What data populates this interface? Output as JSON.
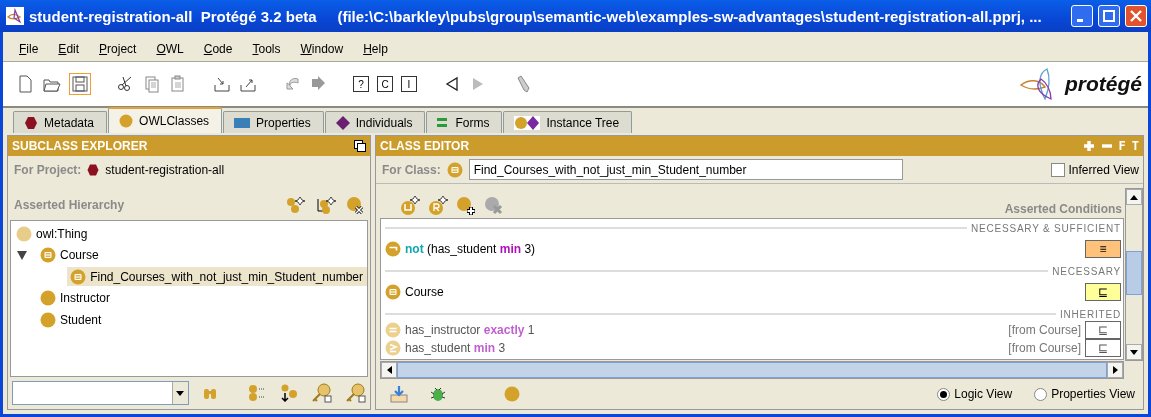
{
  "window": {
    "title": "student-registration-all  Protégé 3.2 beta     (file:\\C:\\barkley\\pubs\\group\\semantic-web\\examples-sw-advantages\\student-registration-all.pprj, ..."
  },
  "menu": [
    "File",
    "Edit",
    "Project",
    "OWL",
    "Code",
    "Tools",
    "Window",
    "Help"
  ],
  "toolbar": {
    "query_buttons": [
      "?",
      "C",
      "I"
    ],
    "logo": "protégé"
  },
  "tabs": [
    {
      "label": "Metadata",
      "kind": "hexagon",
      "selected": false
    },
    {
      "label": "OWLClasses",
      "kind": "circle",
      "selected": true
    },
    {
      "label": "Properties",
      "kind": "rectangle",
      "selected": false
    },
    {
      "label": "Individuals",
      "kind": "diamond",
      "selected": false
    },
    {
      "label": "Forms",
      "kind": "bars",
      "selected": false
    },
    {
      "label": "Instance Tree",
      "kind": "circle-diamond",
      "selected": false
    }
  ],
  "subclass_explorer": {
    "title": "SUBCLASS EXPLORER",
    "project_label": "For Project:",
    "project": "student-registration-all",
    "hierarchy_label": "Asserted Hierarchy",
    "tree": [
      {
        "label": "owl:Thing",
        "kind": "thing",
        "selected": false,
        "children": [
          {
            "label": "Course",
            "kind": "defined",
            "selected": false,
            "expanded": true,
            "children": [
              {
                "label": "Find_Courses_with_not_just_min_Student_number",
                "kind": "defined",
                "selected": true
              }
            ]
          },
          {
            "label": "Instructor",
            "kind": "primitive",
            "selected": false
          },
          {
            "label": "Student",
            "kind": "primitive",
            "selected": false
          }
        ]
      }
    ]
  },
  "class_editor": {
    "title": "CLASS EDITOR",
    "header_buttons": [
      "F",
      "T"
    ],
    "for_class_label": "For Class:",
    "class_name": "Find_Courses_with_not_just_min_Student_number",
    "inferred_view": {
      "label": "Inferred View",
      "checked": false
    },
    "conditions_label": "Asserted Conditions",
    "sections": [
      {
        "title": "NECESSARY & SUFFICIENT",
        "kind": "equivalent",
        "conditions": [
          {
            "kind": "negation",
            "inherited": false,
            "marker": "≡",
            "parts": [
              {
                "text": "not",
                "kind": "negation"
              },
              {
                "text": " (has_student "
              },
              {
                "text": "min",
                "kind": "restriction"
              },
              {
                "text": " 3)"
              }
            ]
          }
        ]
      },
      {
        "title": "NECESSARY",
        "kind": "necessary",
        "conditions": [
          {
            "kind": "class",
            "inherited": false,
            "marker": "⊑",
            "parts": [
              {
                "text": "Course"
              }
            ]
          }
        ]
      },
      {
        "title": "INHERITED",
        "kind": "inherited",
        "conditions": [
          {
            "kind": "exact",
            "inherited": true,
            "source": "[from Course]",
            "marker": "⊑",
            "parts": [
              {
                "text": "has_instructor "
              },
              {
                "text": "exactly",
                "kind": "restriction"
              },
              {
                "text": " 1"
              }
            ]
          },
          {
            "kind": "min",
            "inherited": true,
            "source": "[from Course]",
            "marker": "⊑",
            "parts": [
              {
                "text": "has_student "
              },
              {
                "text": "min",
                "kind": "restriction"
              },
              {
                "text": " 3"
              }
            ]
          }
        ]
      }
    ],
    "views": [
      {
        "label": "Logic View",
        "selected": true
      },
      {
        "label": "Properties View",
        "selected": false
      }
    ]
  }
}
